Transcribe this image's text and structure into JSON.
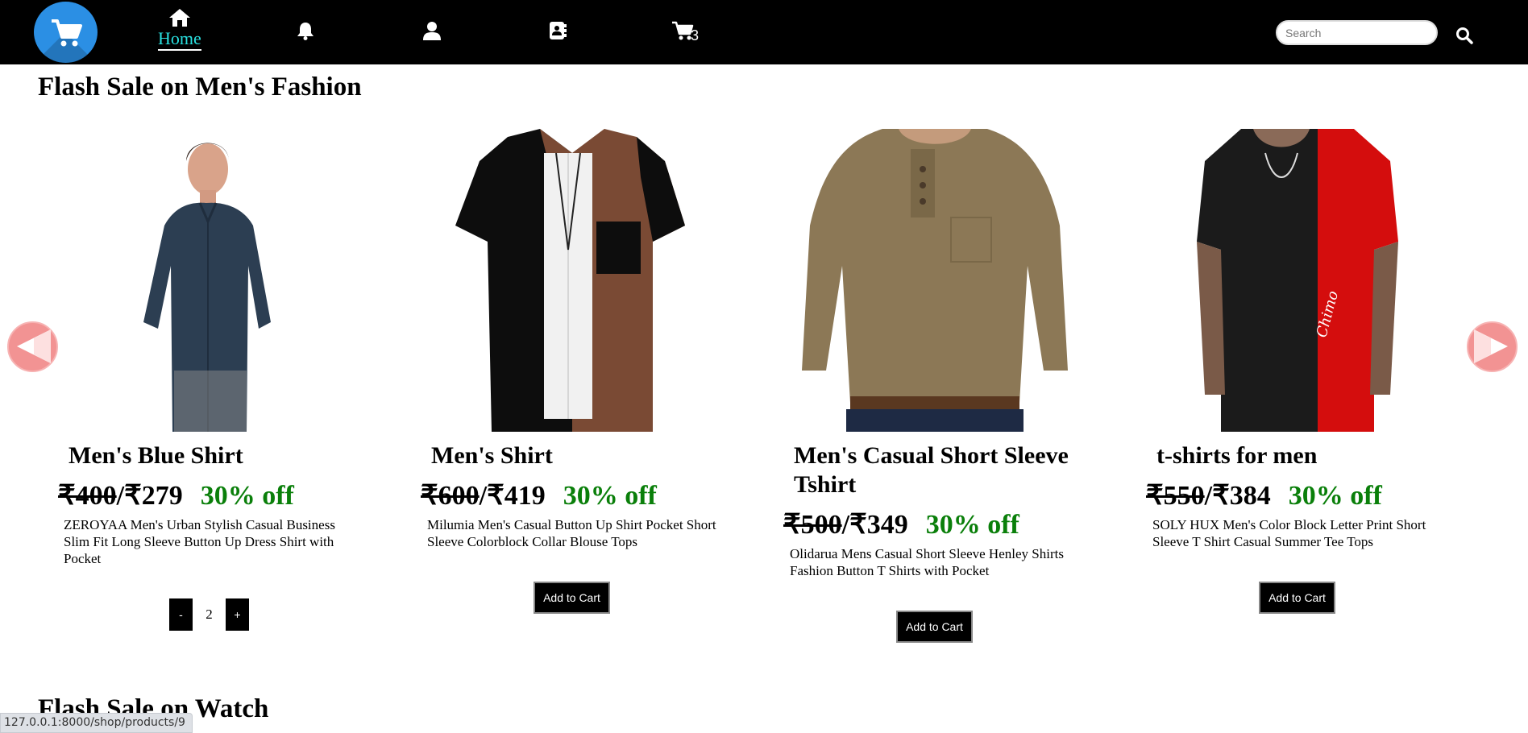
{
  "nav": {
    "home_label": "Home",
    "cart_count": "3",
    "search_placeholder": "Search"
  },
  "sections": [
    {
      "title": "Flash Sale on Men's Fashion"
    },
    {
      "title": "Flash Sale on Watch"
    }
  ],
  "products": [
    {
      "name": "Men's Blue Shirt",
      "old_price": "₹400",
      "new_price": "/₹279",
      "discount": "30% off",
      "description": "ZEROYAA Men's Urban Stylish Casual Business Slim Fit Long Sleeve Button Up Dress Shirt with Pocket",
      "quantity": "2",
      "qty_minus": "-",
      "qty_plus": "+"
    },
    {
      "name": "Men's Shirt",
      "old_price": "₹600",
      "new_price": "/₹419",
      "discount": "30% off",
      "description": "Milumia Men's Casual Button Up Shirt Pocket Short Sleeve Colorblock Collar Blouse Tops",
      "button_label": "Add to Cart"
    },
    {
      "name": "Men's Casual Short Sleeve Tshirt",
      "old_price": "₹500",
      "new_price": "/₹349",
      "discount": "30% off",
      "description": "Olidarua Mens Casual Short Sleeve Henley Shirts Fashion Button T Shirts with Pocket",
      "button_label": "Add to Cart"
    },
    {
      "name": "t-shirts for men",
      "old_price": "₹550",
      "new_price": "/₹384",
      "discount": "30% off",
      "description": "SOLY HUX Men's Color Block Letter Print Short Sleeve T Shirt Casual Summer Tee Tops",
      "button_label": "Add to Cart"
    }
  ],
  "status_url": "127.0.0.1:8000/shop/products/9",
  "colors": {
    "navbar_bg": "#000000",
    "logo_bg": "#2b8fe4",
    "home_active": "#29e0e0",
    "discount_green": "#0a7f0a",
    "arrow_bg": "#f29393"
  },
  "icons": [
    "cart-icon",
    "home-icon",
    "bell-icon",
    "user-icon",
    "contact-book-icon",
    "cart-icon",
    "search-icon",
    "arrow-left-icon",
    "arrow-right-icon"
  ]
}
